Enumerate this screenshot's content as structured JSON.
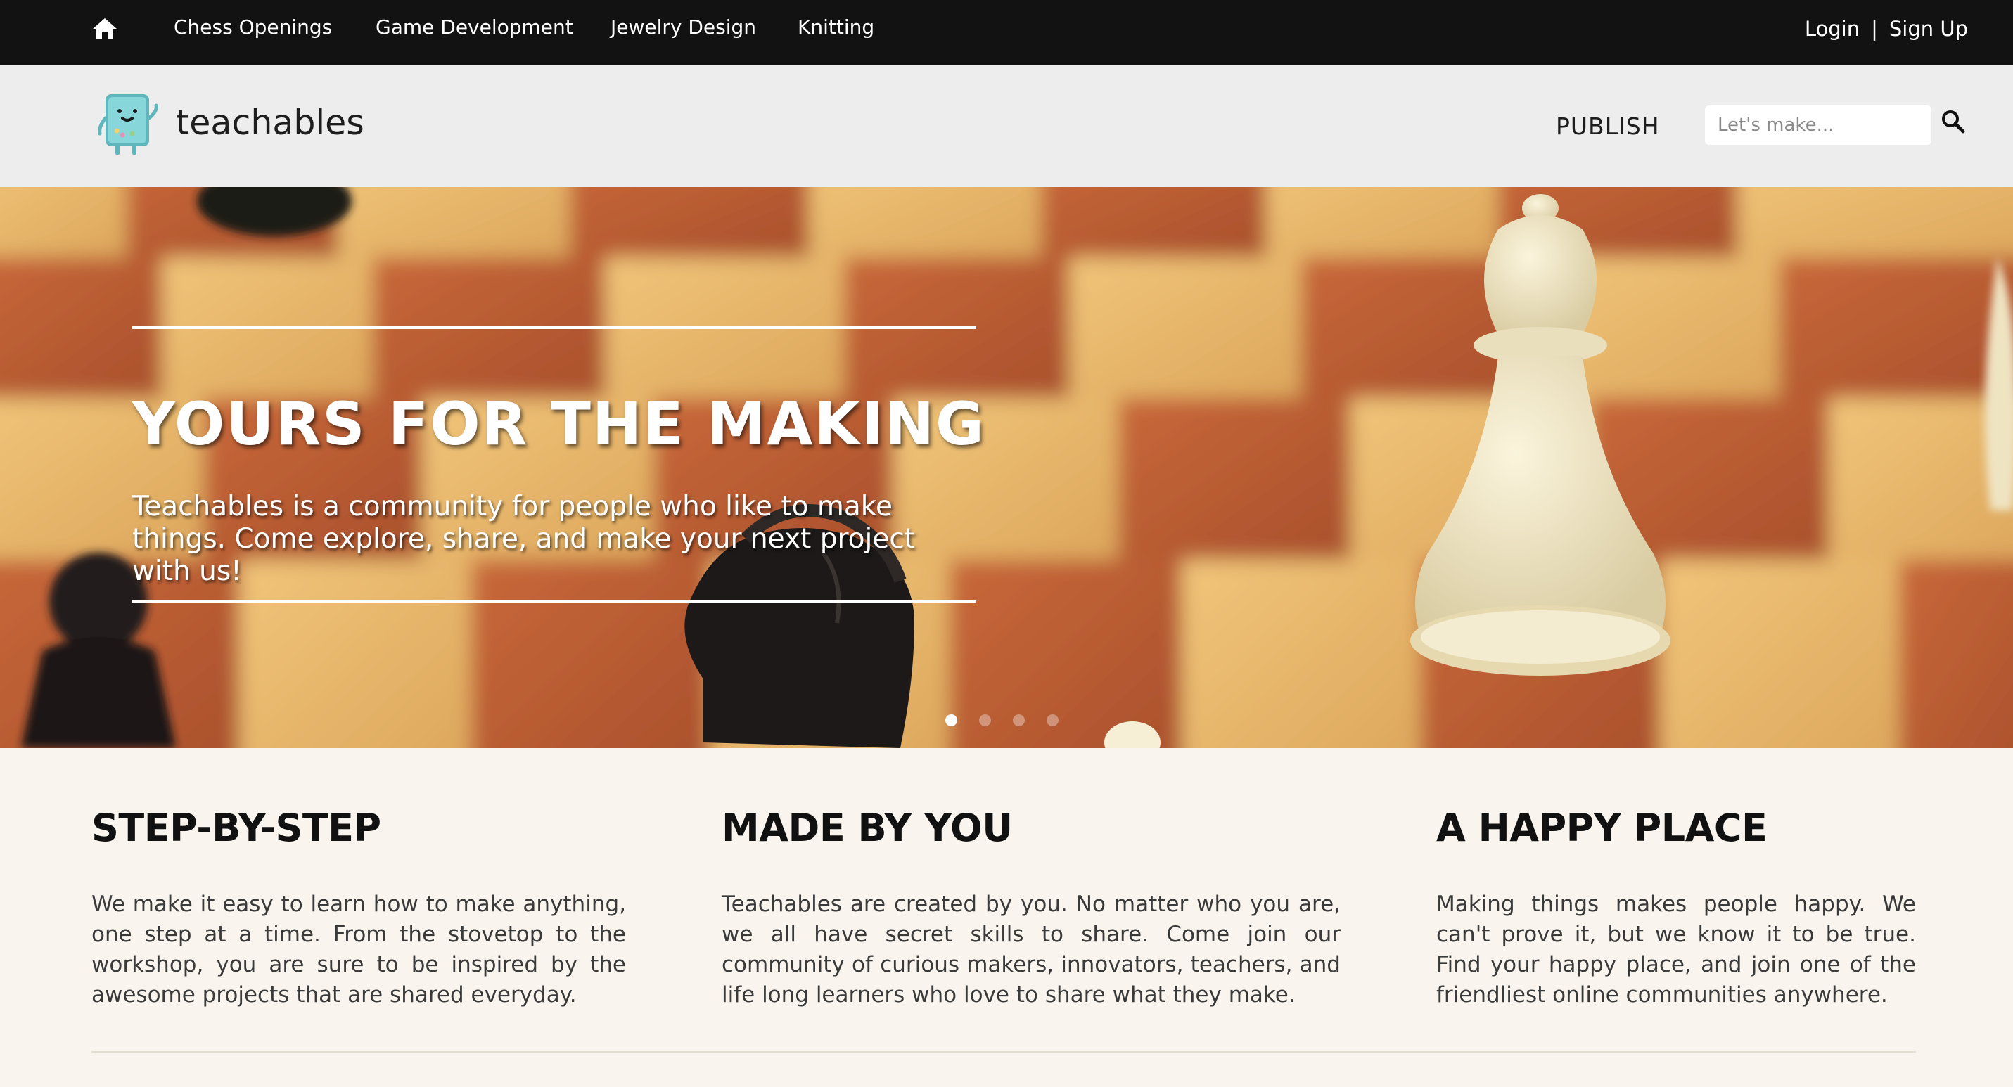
{
  "topnav": {
    "links": [
      "Chess Openings",
      "Game Development",
      "Jewelry Design",
      "Knitting"
    ],
    "login": "Login",
    "separator": "|",
    "signup": "Sign Up"
  },
  "header": {
    "brand": "teachables",
    "publish": "PUBLISH",
    "search_placeholder": "Let's make..."
  },
  "hero": {
    "title": "YOURS FOR THE MAKING",
    "subtitle": "Teachables is a community for people who like to make things. Come explore, share, and make your next project with us!",
    "slides_count": 4,
    "active_slide": 1
  },
  "features": [
    {
      "title": "STEP-BY-STEP",
      "text": "We make it easy to learn how to make anything, one step at a time. From the stovetop to the workshop, you are sure to be inspired by the awesome projects that are shared everyday."
    },
    {
      "title": "MADE BY YOU",
      "text": "Teachables are created by you. No matter who you are, we all have secret skills to share. Come join our community of curious makers, innovators, teachers, and life long learners who love to share what they make."
    },
    {
      "title": "A HAPPY PLACE",
      "text": "Making things makes people happy. We can't prove it, but we know it to be true. Find your happy place, and join one of the friendliest online communities anywhere."
    }
  ],
  "colors": {
    "topnav_bg": "#121212",
    "header_bg": "#ededed",
    "content_bg": "#f9f5ee",
    "logo_teal": "#7dd3d8"
  },
  "icons": {
    "home": "home-icon",
    "search": "search-icon",
    "logo": "teachables-robot-logo"
  }
}
